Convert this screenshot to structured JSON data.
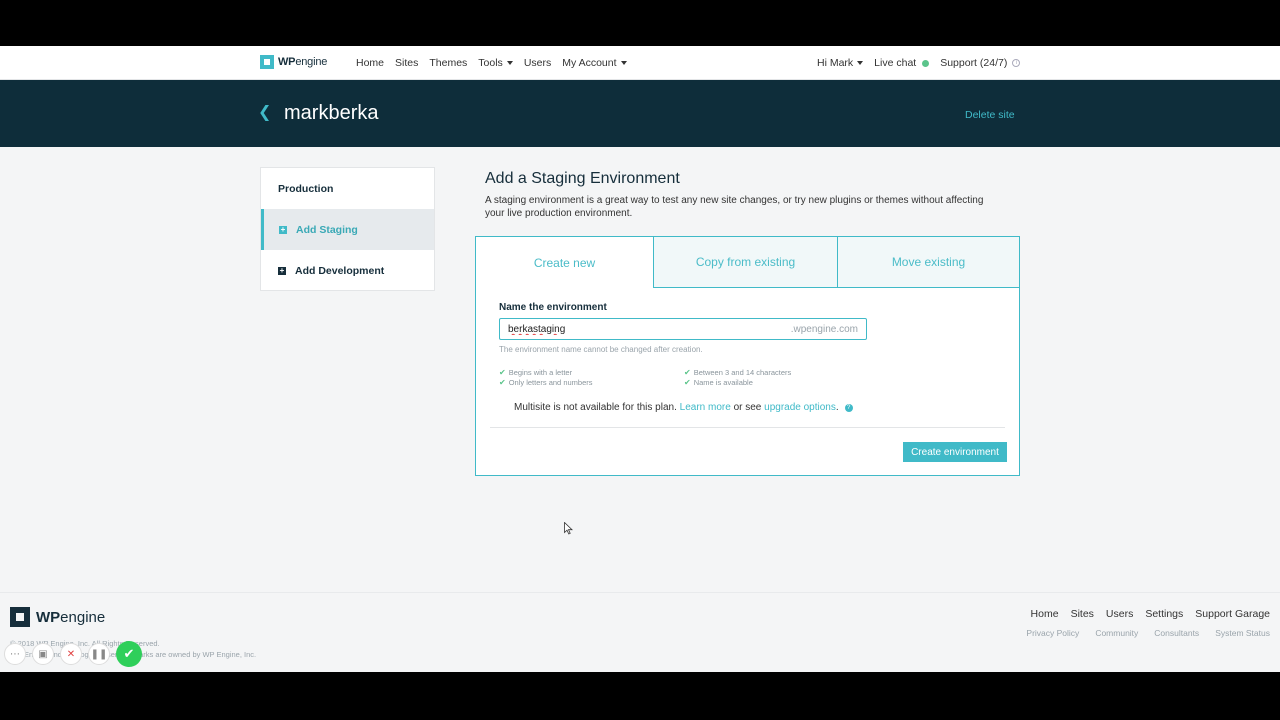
{
  "topnav": {
    "logo_bold": "WP",
    "logo_rest": "engine",
    "items": [
      "Home",
      "Sites",
      "Themes",
      "Tools",
      "Users",
      "My Account"
    ],
    "greeting": "Hi Mark",
    "live_chat": "Live chat",
    "support": "Support (24/7)"
  },
  "site": {
    "name": "markberka",
    "delete_label": "Delete site"
  },
  "sidebar": {
    "items": [
      {
        "label": "Production"
      },
      {
        "label": "Add Staging"
      },
      {
        "label": "Add Development"
      }
    ]
  },
  "main": {
    "title": "Add a Staging Environment",
    "description": "A staging environment is a great way to test any new site changes, or try new plugins or themes without affecting your live production environment.",
    "tabs": [
      "Create new",
      "Copy from existing",
      "Move existing"
    ],
    "field_label": "Name the environment",
    "field_value": "berkastaging",
    "field_suffix": ".wpengine.com",
    "field_note": "The environment name cannot be changed after creation.",
    "checks": [
      "Begins with a letter",
      "Between 3 and 14 characters",
      "Only letters and numbers",
      "Name is available"
    ],
    "multisite_text": "Multisite is not available for this plan.",
    "learn_more": "Learn more",
    "or_see": "or see",
    "upgrade_options": "upgrade options",
    "create_button": "Create environment"
  },
  "footer": {
    "logo_bold": "WP",
    "logo_rest": "engine",
    "copyright_line1": "© 2018 WP Engine, Inc. All Rights Reserved.",
    "copyright_line2": "WP Engine and the cog logo service marks are owned by WP Engine, Inc.",
    "links": [
      "Home",
      "Sites",
      "Users",
      "Settings",
      "Support Garage"
    ],
    "sublinks": [
      "Privacy Policy",
      "Community",
      "Consultants",
      "System Status"
    ]
  },
  "colors": {
    "accent": "#40bac8",
    "header_bg": "#0e2d3a",
    "available": "#5bc48b"
  }
}
